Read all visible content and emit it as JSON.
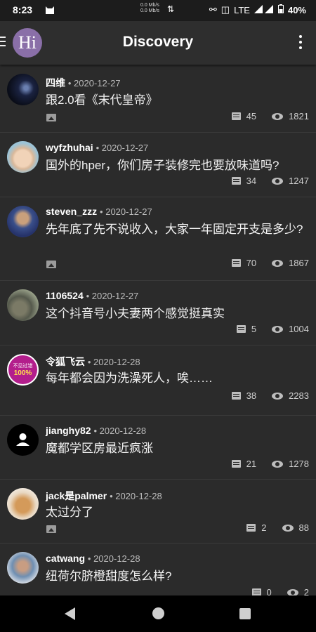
{
  "status": {
    "time": "8:23",
    "net_speed_up": "0.0 Mb/s",
    "net_speed_down": "0.0 Mb/s",
    "lte": "LTE",
    "battery": "40%"
  },
  "appbar": {
    "avatar_text": "Hi",
    "title": "Discovery"
  },
  "posts": [
    {
      "user": "四维",
      "date": "• 2020-12-27",
      "text": "跟2.0看《末代皇帝》",
      "has_image": true,
      "comments": "45",
      "views": "1821"
    },
    {
      "user": "wyfzhuhai",
      "date": "• 2020-12-27",
      "text": "国外的hper，你们房子装修完也要放味道吗?",
      "has_image": false,
      "comments": "34",
      "views": "1247"
    },
    {
      "user": "steven_zzz",
      "date": "• 2020-12-27",
      "text": "先年底了先不说收入，大家一年固定开支是多少?",
      "has_image": true,
      "comments": "70",
      "views": "1867"
    },
    {
      "user": "1106524",
      "date": "• 2020-12-27",
      "text": "这个抖音号小夫妻两个感觉挺真实",
      "has_image": false,
      "comments": "5",
      "views": "1004"
    },
    {
      "user": "令狐飞云",
      "date": "• 2020-12-28",
      "text": "每年都会因为洗澡死人，唉……",
      "has_image": false,
      "comments": "38",
      "views": "2283",
      "avatar_badge_top": "不见过错",
      "avatar_badge_bottom": "100%"
    },
    {
      "user": "jianghy82",
      "date": "• 2020-12-28",
      "text": "魔都学区房最近疯涨",
      "has_image": false,
      "comments": "21",
      "views": "1278"
    },
    {
      "user": "jack是palmer",
      "date": "• 2020-12-28",
      "text": "太过分了",
      "has_image": true,
      "comments": "2",
      "views": "88"
    },
    {
      "user": "catwang",
      "date": "• 2020-12-28",
      "text": "纽荷尔脐橙甜度怎么样?",
      "has_image": false,
      "comments": "0",
      "views": "2"
    }
  ]
}
